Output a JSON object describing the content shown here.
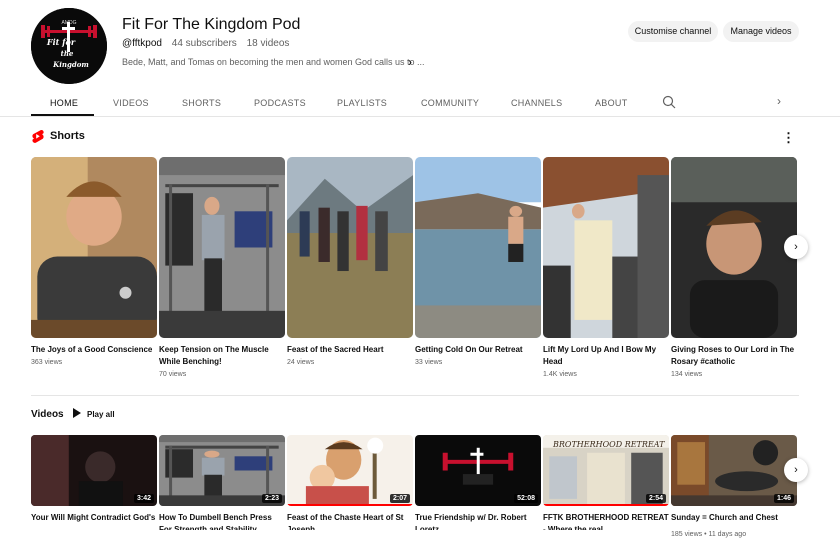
{
  "channel": {
    "name": "Fit For The Kingdom Pod",
    "handle": "@fftkpod",
    "subscribers": "44 subscribers",
    "videos_count": "18 videos",
    "description": "Bede, Matt, and Tomas on becoming the men and women God calls us to ...",
    "avatar_text": [
      "AMDG",
      "Fit for",
      "the",
      "Kingdom"
    ],
    "customise_label": "Customise channel",
    "manage_label": "Manage videos"
  },
  "tabs": [
    {
      "label": "HOME",
      "active": true
    },
    {
      "label": "VIDEOS"
    },
    {
      "label": "SHORTS"
    },
    {
      "label": "PODCASTS"
    },
    {
      "label": "PLAYLISTS"
    },
    {
      "label": "COMMUNITY"
    },
    {
      "label": "CHANNELS"
    },
    {
      "label": "ABOUT"
    }
  ],
  "shorts": {
    "title": "Shorts",
    "items": [
      {
        "title": "The Joys of a Good Conscience",
        "views": "363 views",
        "scene": "person-warm"
      },
      {
        "title": "Keep Tension on The Muscle While Benching!",
        "views": "70 views",
        "scene": "gym"
      },
      {
        "title": "Feast of the Sacred Heart",
        "views": "24 views",
        "scene": "hike"
      },
      {
        "title": "Getting Cold On Our Retreat",
        "views": "33 views",
        "scene": "river"
      },
      {
        "title": "Lift My Lord Up And I Bow My Head",
        "views": "1.4K views",
        "scene": "mass"
      },
      {
        "title": "Giving Roses to Our Lord in The Rosary #catholic",
        "views": "134 views",
        "scene": "car"
      }
    ]
  },
  "videos": {
    "title": "Videos",
    "play_all_label": "Play all",
    "items": [
      {
        "title": "Your Will Might Contradict God's",
        "duration": "3:42",
        "meta": "",
        "progress": 0.0,
        "scene": "dark-person"
      },
      {
        "title": "How To Dumbell Bench Press For Strength and Stability",
        "duration": "2:23",
        "meta": "",
        "progress": 0.0,
        "scene": "gym"
      },
      {
        "title": "Feast of the Chaste Heart of St Joseph",
        "duration": "2:07",
        "meta": "",
        "progress": 1.0,
        "scene": "joseph"
      },
      {
        "title": "True Friendship w/ Dr. Robert Loretz",
        "duration": "52:08",
        "meta": "",
        "progress": 0.0,
        "scene": "logo"
      },
      {
        "title": "FFTK BROTHERHOOD RETREAT - Where the real…",
        "duration": "2:54",
        "meta": "",
        "progress": 1.0,
        "thumb_text": "BROTHERHOOD RETREAT",
        "scene": "retreat"
      },
      {
        "title": "Sunday = Church and Chest",
        "duration": "1:46",
        "meta": "185 views • 11 days ago",
        "progress": 0.0,
        "scene": "bench"
      }
    ]
  },
  "colors": {
    "accent_red": "#ff0000",
    "text_primary": "#0f0f0f",
    "text_secondary": "#606060",
    "chip_bg": "#f2f2f2"
  }
}
